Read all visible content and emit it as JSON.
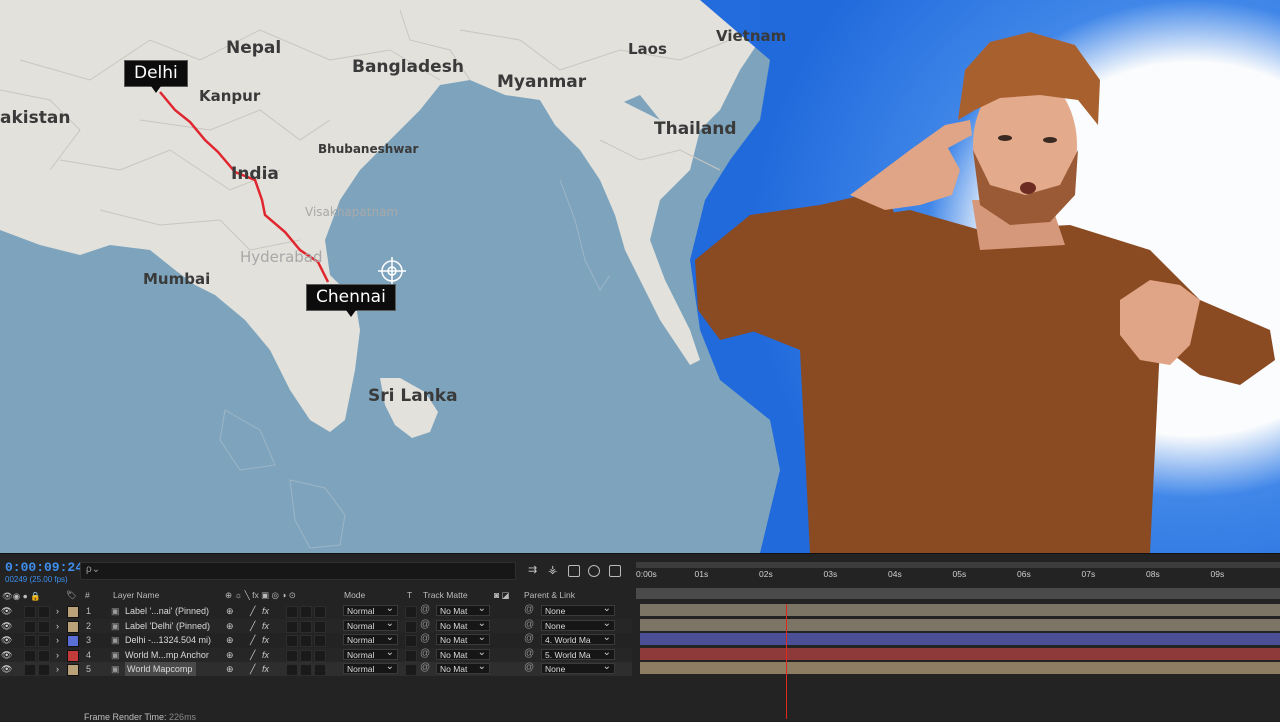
{
  "map": {
    "places": {
      "nepal": "Nepal",
      "bangladesh": "Bangladesh",
      "laos": "Laos",
      "vietnam": "Vietnam",
      "pakistan": "akistan",
      "kanpur": "Kanpur",
      "myanmar": "Myanmar",
      "thailand": "Thailand",
      "bhubaneshwar": "Bhubaneshwar",
      "india": "India",
      "visakhapatnam": "Visakhapatnam",
      "hyderabad": "Hyderabad",
      "mumbai": "Mumbai",
      "srilanka": "Sri Lanka"
    },
    "labels": {
      "delhi": "Delhi",
      "chennai": "Chennai"
    },
    "colors": {
      "water": "#7ea4bd",
      "land": "#e3e1dc",
      "route": "#e0262e",
      "backdrop": "#1f6ee0"
    }
  },
  "timeline": {
    "timecode": "0:00:09:24",
    "fps": "00249 (25.00 fps)",
    "search_placeholder": "ρ⌄",
    "headers": {
      "num": "#",
      "layer_name": "Layer Name",
      "switches": "⊕ ☼ ╲ fx ▣ ◎ ◑ ⊙",
      "mode": "Mode",
      "t": "T",
      "track_matte": "Track Matte",
      "parent": "Parent & Link"
    },
    "ticks": [
      "0:00s",
      "01s",
      "02s",
      "03s",
      "04s",
      "05s",
      "06s",
      "07s",
      "08s",
      "09s"
    ],
    "layers": [
      {
        "num": "1",
        "name": "Label '...nai' (Pinned)",
        "color": "#b9a27a",
        "mode": "Normal",
        "matte": "No Mat",
        "parent": "None",
        "bar_color": "#7c7464"
      },
      {
        "num": "2",
        "name": "Label 'Delhi' (Pinned)",
        "color": "#b9a27a",
        "mode": "Normal",
        "matte": "No Mat",
        "parent": "None",
        "bar_color": "#7c7464"
      },
      {
        "num": "3",
        "name": "Delhi -...1324.504 mi)",
        "color": "#5a6fd6",
        "mode": "Normal",
        "matte": "No Mat",
        "parent": "4. World Ma",
        "bar_color": "#4a4f96"
      },
      {
        "num": "4",
        "name": "World M...mp Anchor",
        "color": "#c23b3b",
        "mode": "Normal",
        "matte": "No Mat",
        "parent": "5. World Ma",
        "bar_color": "#8e3a3a"
      },
      {
        "num": "5",
        "name": "World Mapcomp",
        "color": "#b9a27a",
        "mode": "Normal",
        "matte": "No Mat",
        "parent": "None",
        "bar_color": "#8d7e63"
      }
    ],
    "status": "Frame Render Time:",
    "status_value": "226ms"
  }
}
